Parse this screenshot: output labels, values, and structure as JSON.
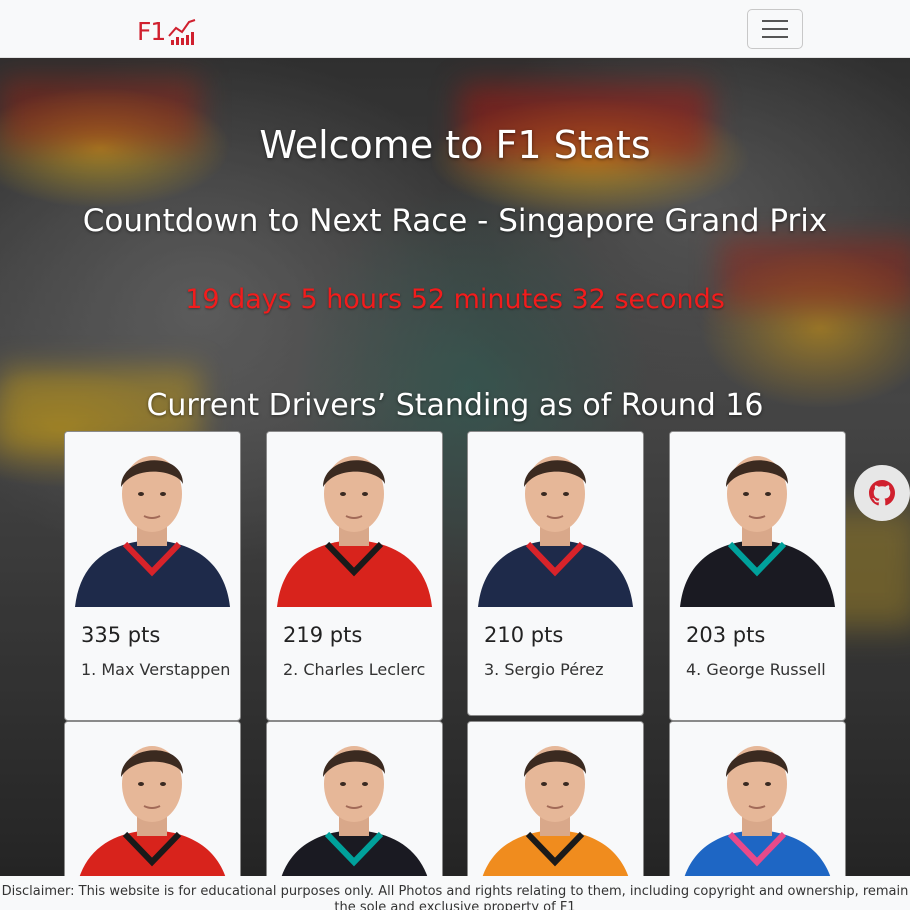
{
  "navbar": {
    "logo_text": "F1",
    "brand_color": "#d0202e",
    "menu_icon": "hamburger-icon"
  },
  "hero": {
    "welcome": "Welcome to F1 Stats",
    "countdown_title": "Countdown to Next Race - Singapore Grand Prix",
    "countdown": "19 days 5 hours 52 minutes 32 seconds",
    "countdown_color": "#f21c1c",
    "standings_title": "Current Drivers’ Standing as of Round 16"
  },
  "drivers": [
    {
      "pts": "335 pts",
      "name": "1. Max Verstappen",
      "team_color": "#1e2a4a",
      "accent": "#d8232a"
    },
    {
      "pts": "219 pts",
      "name": "2. Charles Leclerc",
      "team_color": "#d8231c",
      "accent": "#1a1a1a"
    },
    {
      "pts": "210 pts",
      "name": "3. Sergio Pérez",
      "team_color": "#1e2a4a",
      "accent": "#d8232a"
    },
    {
      "pts": "203 pts",
      "name": "4. George Russell",
      "team_color": "#1a1a22",
      "accent": "#00a19b"
    },
    {
      "pts": "",
      "name": "",
      "team_color": "#d8231c",
      "accent": "#1a1a1a"
    },
    {
      "pts": "",
      "name": "",
      "team_color": "#1a1a22",
      "accent": "#00a19b"
    },
    {
      "pts": "",
      "name": "",
      "team_color": "#f08c1e",
      "accent": "#1a1a1a"
    },
    {
      "pts": "",
      "name": "",
      "team_color": "#1e66c4",
      "accent": "#e84a8a"
    }
  ],
  "github_icon": "github-icon",
  "footer": {
    "disclaimer": "Disclaimer: This website is for educational purposes only. All Photos and rights relating to them, including copyright and ownership, remain the sole and exclusive property of F1"
  }
}
